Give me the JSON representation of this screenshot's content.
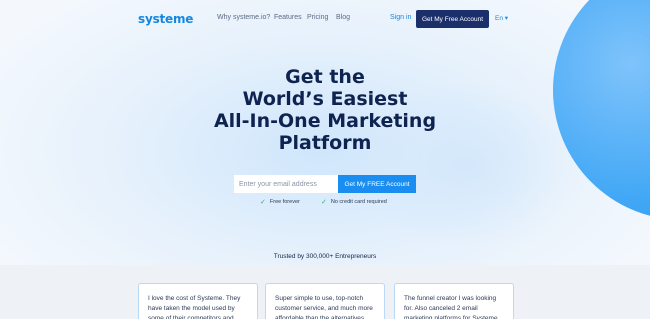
{
  "header": {
    "logo": "systeme",
    "nav": [
      "Why systeme.io?",
      "Features",
      "Pricing",
      "Blog"
    ],
    "sign_in": "Sign in",
    "cta": "Get My Free Account",
    "language": "En ▾"
  },
  "hero": {
    "headline_lines": [
      "Get the",
      "World’s Easiest",
      "All-In-One Marketing",
      "Platform"
    ],
    "email_placeholder": "Enter your email address",
    "submit_label": "Get My FREE Account",
    "checks": [
      "Free forever",
      "No credit card required"
    ],
    "trusted": "Trusted by 300,000+ Entrepreneurs"
  },
  "testimonials": [
    "I love the cost of Systeme. They have taken the model used by some of their competitors and",
    "Super simple to use, top-notch customer service, and much more affordable than the alternatives",
    "The funnel creator I was looking for. Also canceled 2 email marketing platforms for Systeme"
  ],
  "colors": {
    "brand": "#1488e0",
    "navy": "#1b2f6b",
    "accent": "#1a8ef0",
    "check": "#33b36b"
  }
}
